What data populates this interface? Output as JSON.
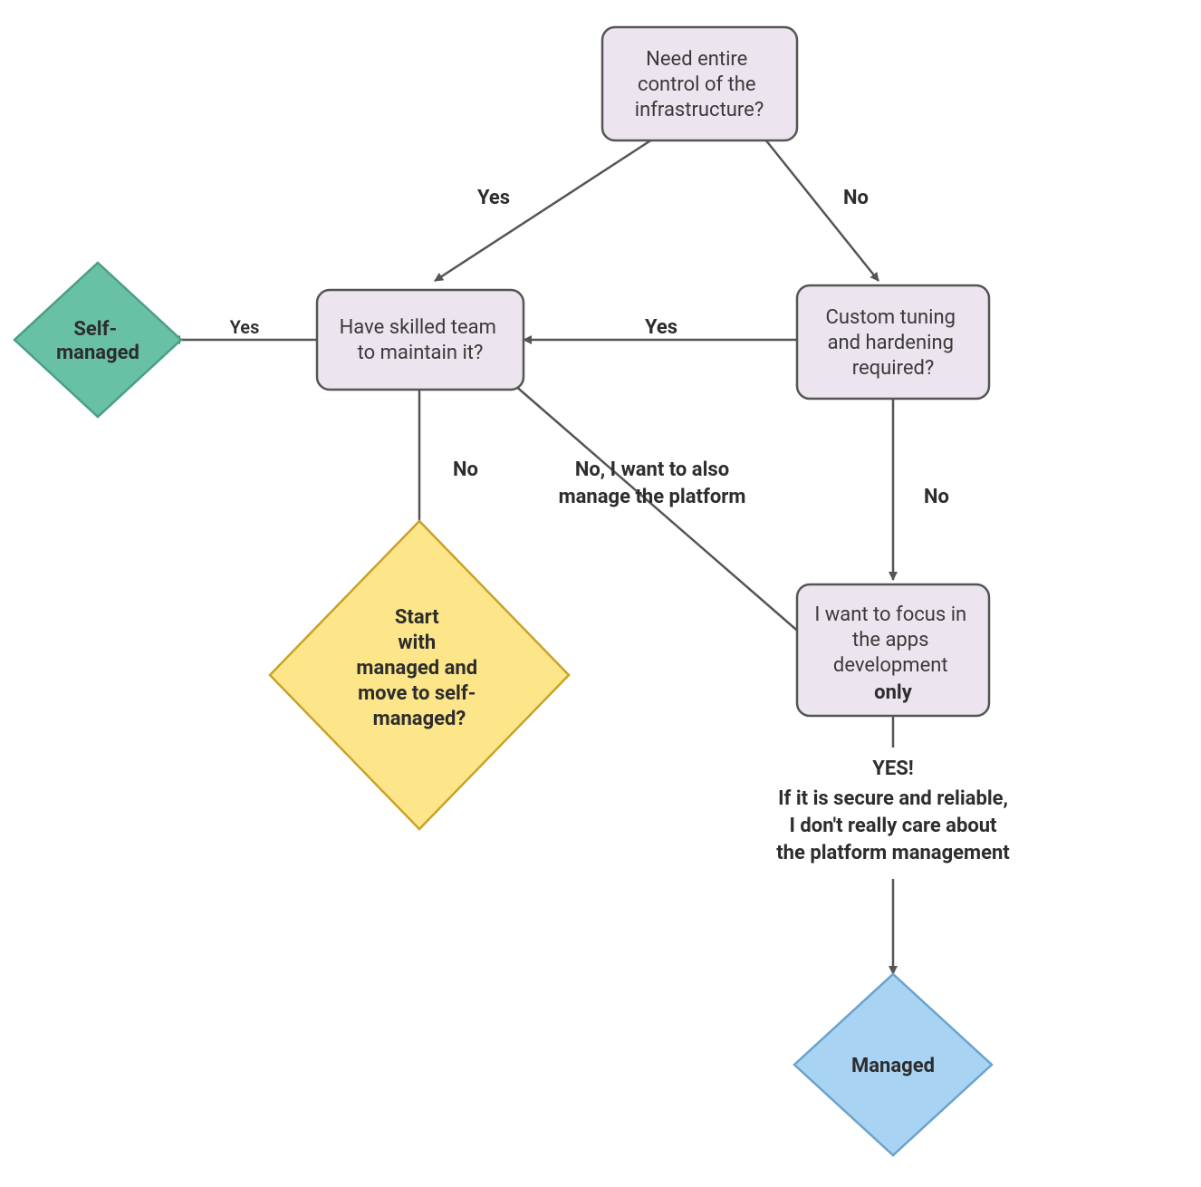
{
  "nodes": {
    "q_control": "Need entire control of the infrastructure?",
    "q_skilled": "Have skilled team to maintain it?",
    "q_tuning": "Custom tuning and hardening required?",
    "q_focus_pre": "I want to focus in the apps development",
    "q_focus_bold": "only",
    "out_self": "Self-managed",
    "out_start": "Start with managed and move to self-managed?",
    "out_managed": "Managed"
  },
  "edges": {
    "yes": "Yes",
    "no": "No",
    "no_manage_platform_l1": "No, I want to also",
    "no_manage_platform_l2": "manage the platform",
    "yes_excl": "YES!",
    "yes_long_l1": "If it is secure and reliable,",
    "yes_long_l2": "I don't really care about",
    "yes_long_l3": "the platform management"
  },
  "colors": {
    "rect_fill": "#ece4ee",
    "rect_stroke": "#555555",
    "teal_fill": "#68c1a6",
    "teal_stroke": "#4a9e86",
    "yellow_fill": "#fde68a",
    "yellow_stroke": "#c9a227",
    "blue_fill": "#a9d3f2",
    "blue_stroke": "#6aa3cc",
    "arrow": "#555555"
  }
}
